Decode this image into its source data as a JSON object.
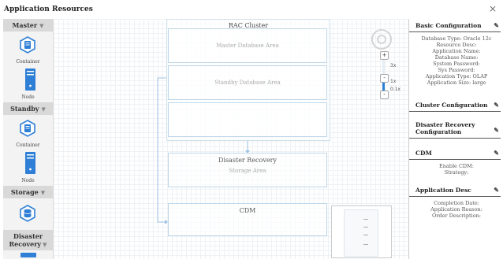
{
  "window": {
    "title": "Application Resources",
    "close_glyph": "×"
  },
  "palette": {
    "groups": [
      {
        "label": "Master",
        "items": [
          "Container",
          "Node"
        ]
      },
      {
        "label": "Standby",
        "items": [
          "Container",
          "Node"
        ]
      },
      {
        "label": "Storage",
        "items": []
      },
      {
        "label": "Disaster Recovery",
        "items": []
      }
    ],
    "arrow_glyph": "▼"
  },
  "canvas": {
    "cluster_title": "RAC Cluster",
    "master_area": "Master Database Area",
    "standby_area": "Standby Database Area",
    "dr_title": "Disaster Recovery",
    "dr_sub": "Storage Area",
    "cdm_title": "CDM",
    "zoom": {
      "plus": "+",
      "minus": "-",
      "level_3x": "3x",
      "level_1x": "1x",
      "level_01x": "0.1x"
    },
    "accent": "#2f7fd6"
  },
  "panel": {
    "sections": [
      {
        "title": "Basic Configuration",
        "lines": [
          "Database Type: Oracle 12c",
          "Resource Desc:",
          "Application Name:",
          "Database Name:",
          "System Password:",
          "Sys Password:",
          "Application Type: OLAP",
          "Application Size: large"
        ]
      },
      {
        "title": "Cluster Configuration",
        "lines": []
      },
      {
        "title": "Disaster Recovery Configuration",
        "lines": []
      },
      {
        "title": "CDM",
        "lines": [
          "Enable CDM:",
          "Strategy:"
        ]
      },
      {
        "title": "Application Desc",
        "lines": [
          "Completion Date:",
          "Application Reason:",
          "Order Description:"
        ]
      }
    ],
    "edit_glyph": "✎"
  }
}
